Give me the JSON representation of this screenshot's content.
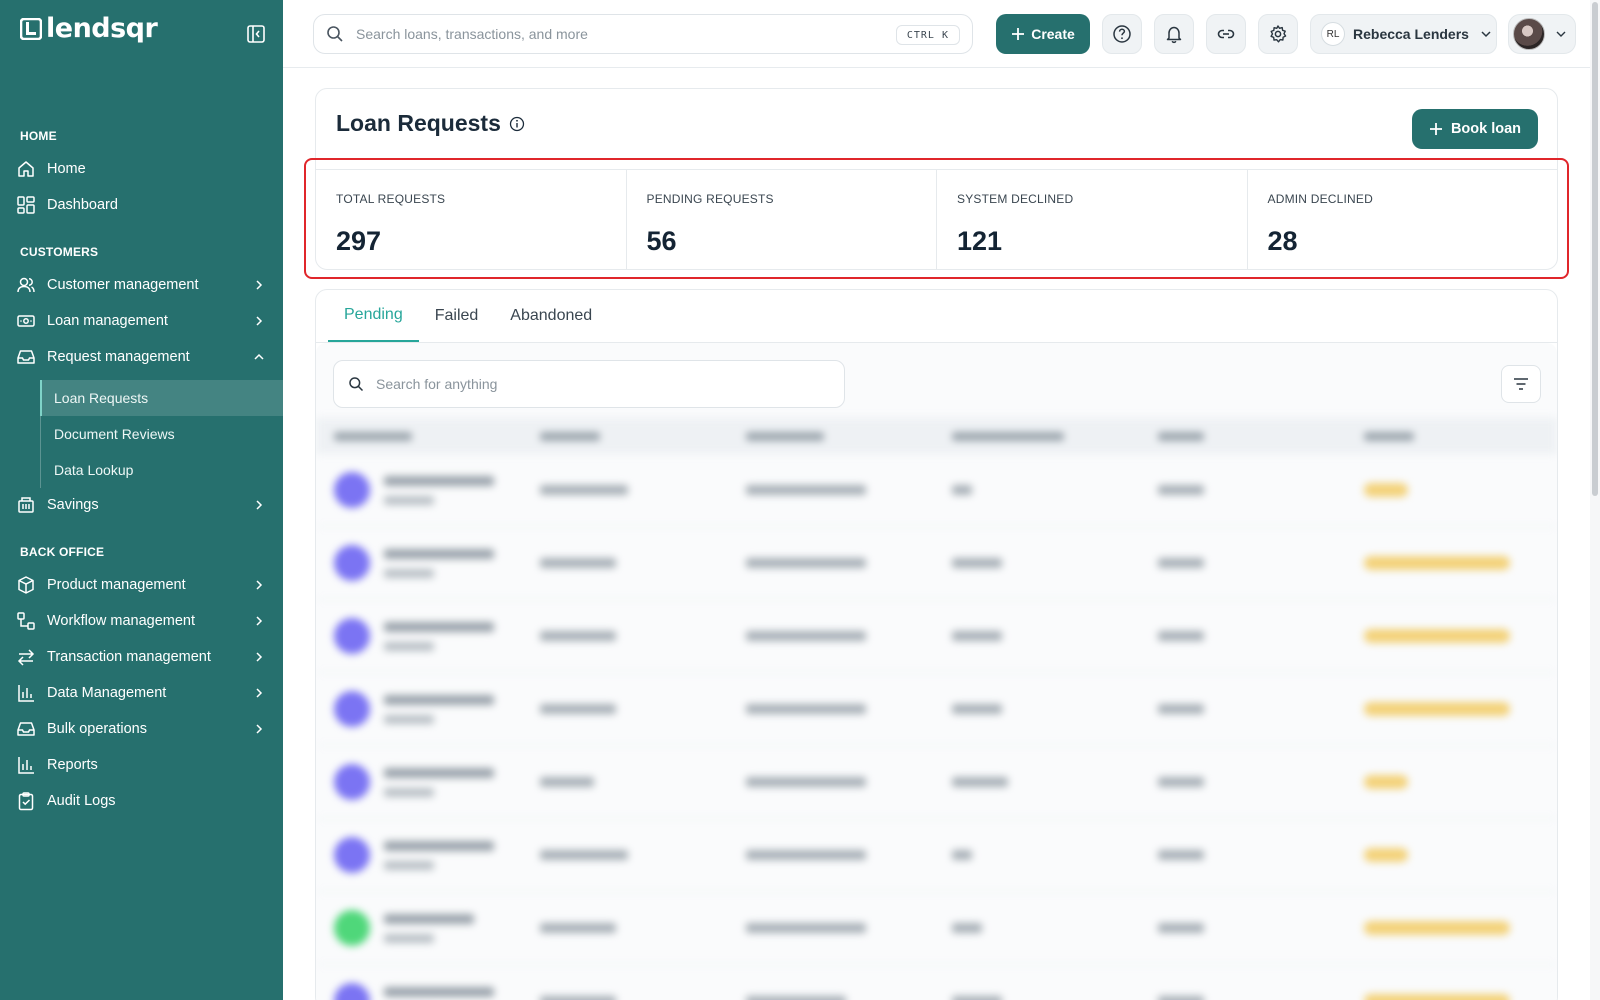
{
  "brand": {
    "name": "lendsqr"
  },
  "sidebar": {
    "sections": {
      "home": "HOME",
      "customers": "CUSTOMERS",
      "back_office": "BACK OFFICE"
    },
    "items": {
      "home": "Home",
      "dashboard": "Dashboard",
      "customer_management": "Customer management",
      "loan_management": "Loan management",
      "request_management": "Request management",
      "savings": "Savings",
      "product_management": "Product management",
      "workflow_management": "Workflow management",
      "transaction_management": "Transaction management",
      "data_management": "Data Management",
      "bulk_operations": "Bulk operations",
      "reports": "Reports",
      "audit_logs": "Audit Logs"
    },
    "request_submenu": {
      "loan_requests": "Loan Requests",
      "document_reviews": "Document Reviews",
      "data_lookup": "Data Lookup"
    },
    "active_item": "Loan Requests"
  },
  "topbar": {
    "search_placeholder": "Search loans, transactions, and more",
    "shortcut": "CTRL K",
    "create_label": "Create",
    "user_initials": "RL",
    "user_name": "Rebecca Lenders"
  },
  "page": {
    "title": "Loan Requests",
    "book_loan_label": "Book loan",
    "stats": [
      {
        "label": "TOTAL REQUESTS",
        "value": "297"
      },
      {
        "label": "PENDING REQUESTS",
        "value": "56"
      },
      {
        "label": "SYSTEM DECLINED",
        "value": "121"
      },
      {
        "label": "ADMIN DECLINED",
        "value": "28"
      }
    ],
    "tabs": [
      "Pending",
      "Failed",
      "Abandoned"
    ],
    "active_tab": "Pending",
    "table_search_placeholder": "Search for anything"
  },
  "colors": {
    "sidebar_bg": "#26706e",
    "primary": "#26706e",
    "tab_active": "#27a69a",
    "highlight_border": "#e0262b"
  }
}
